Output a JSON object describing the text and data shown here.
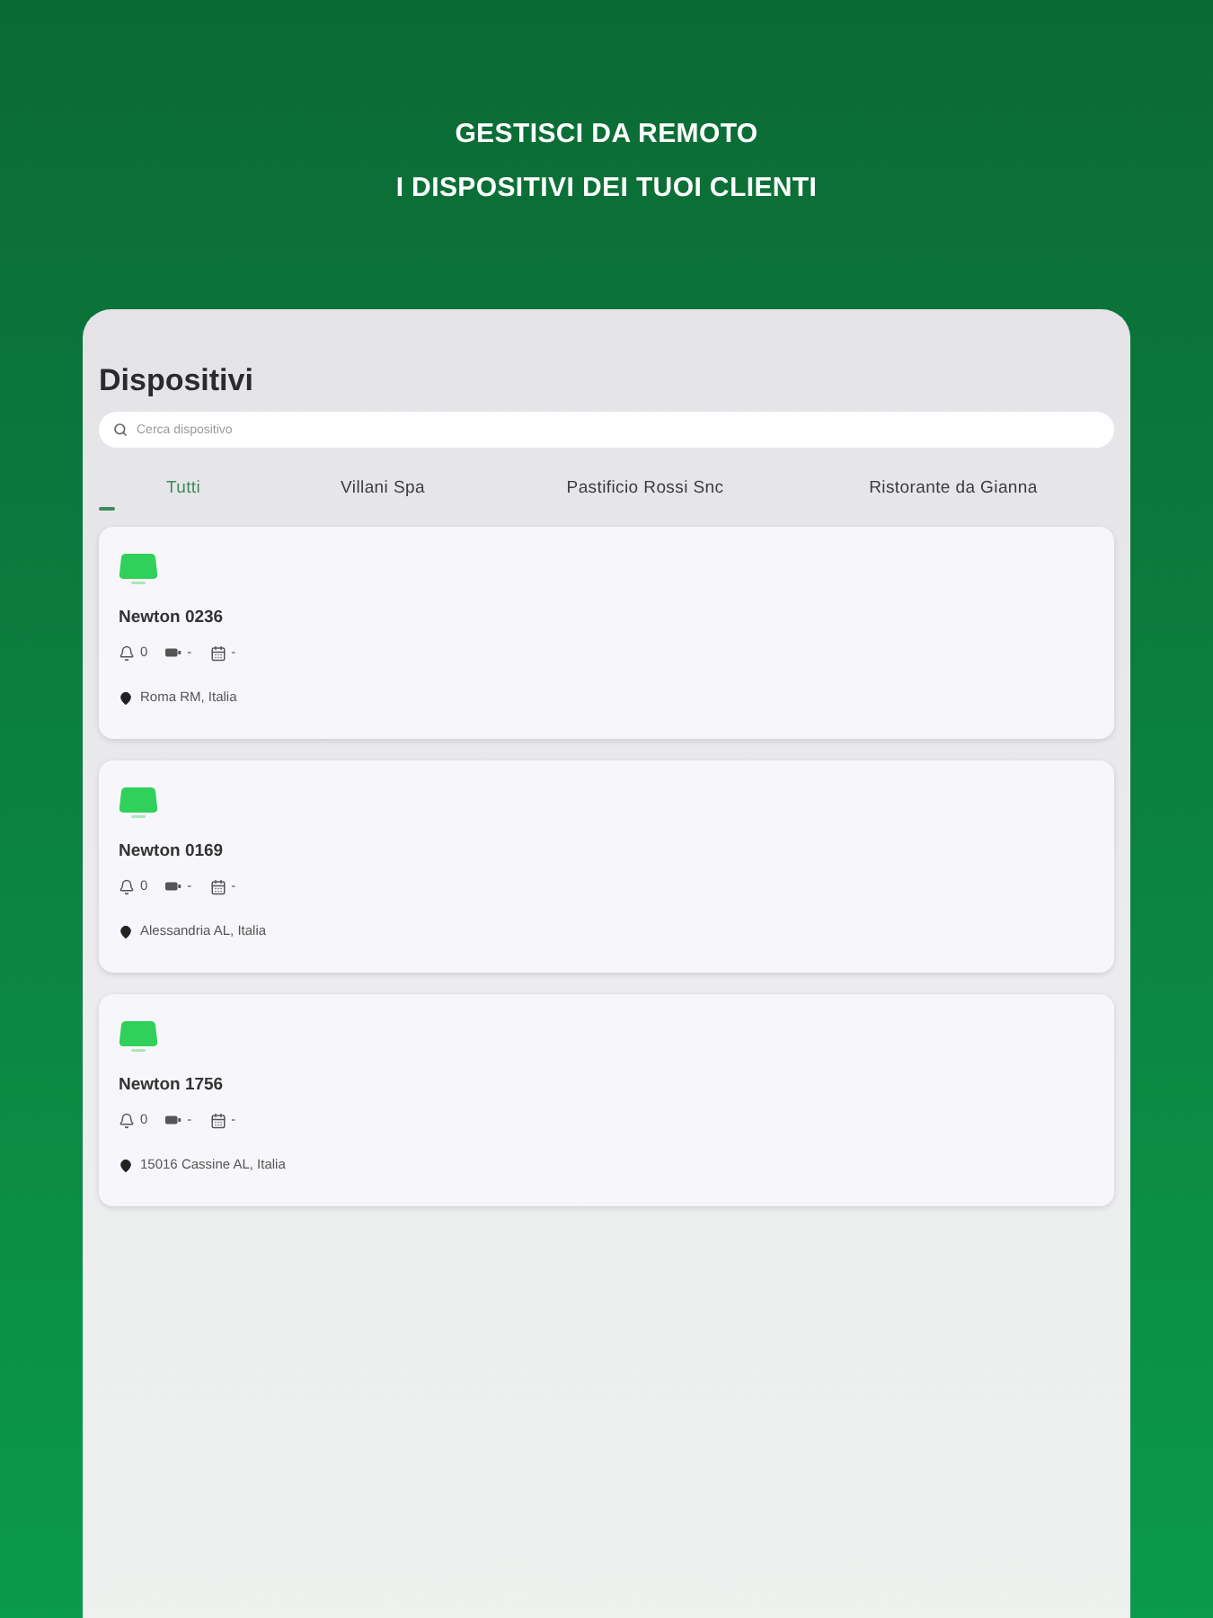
{
  "banner": {
    "lines": [
      "GESTISCI DA REMOTO",
      "I DISPOSITIVI DEI TUOI CLIENTI"
    ]
  },
  "panel": {
    "title": "Dispositivi",
    "search": {
      "placeholder": "Cerca dispositivo"
    },
    "tabs": [
      {
        "label": "Tutti",
        "selected": true
      },
      {
        "label": "Villani Spa",
        "selected": false
      },
      {
        "label": "Pastificio Rossi Snc",
        "selected": false
      },
      {
        "label": "Ristorante da Gianna",
        "selected": false
      }
    ],
    "devices": [
      {
        "name": "Newton 0236",
        "stats": [
          {
            "kind": "alarms",
            "value": "0"
          },
          {
            "kind": "battery",
            "value": "-"
          },
          {
            "kind": "calendar",
            "value": "-"
          }
        ],
        "location": "Roma RM, Italia"
      },
      {
        "name": "Newton 0169",
        "stats": [
          {
            "kind": "alarms",
            "value": "0"
          },
          {
            "kind": "battery",
            "value": "-"
          },
          {
            "kind": "calendar",
            "value": "-"
          }
        ],
        "location": "Alessandria AL, Italia"
      },
      {
        "name": "Newton 1756",
        "stats": [
          {
            "kind": "alarms",
            "value": "0"
          },
          {
            "kind": "battery",
            "value": "-"
          },
          {
            "kind": "calendar",
            "value": "-"
          }
        ],
        "location": "15016 Cassine AL, Italia"
      }
    ]
  }
}
